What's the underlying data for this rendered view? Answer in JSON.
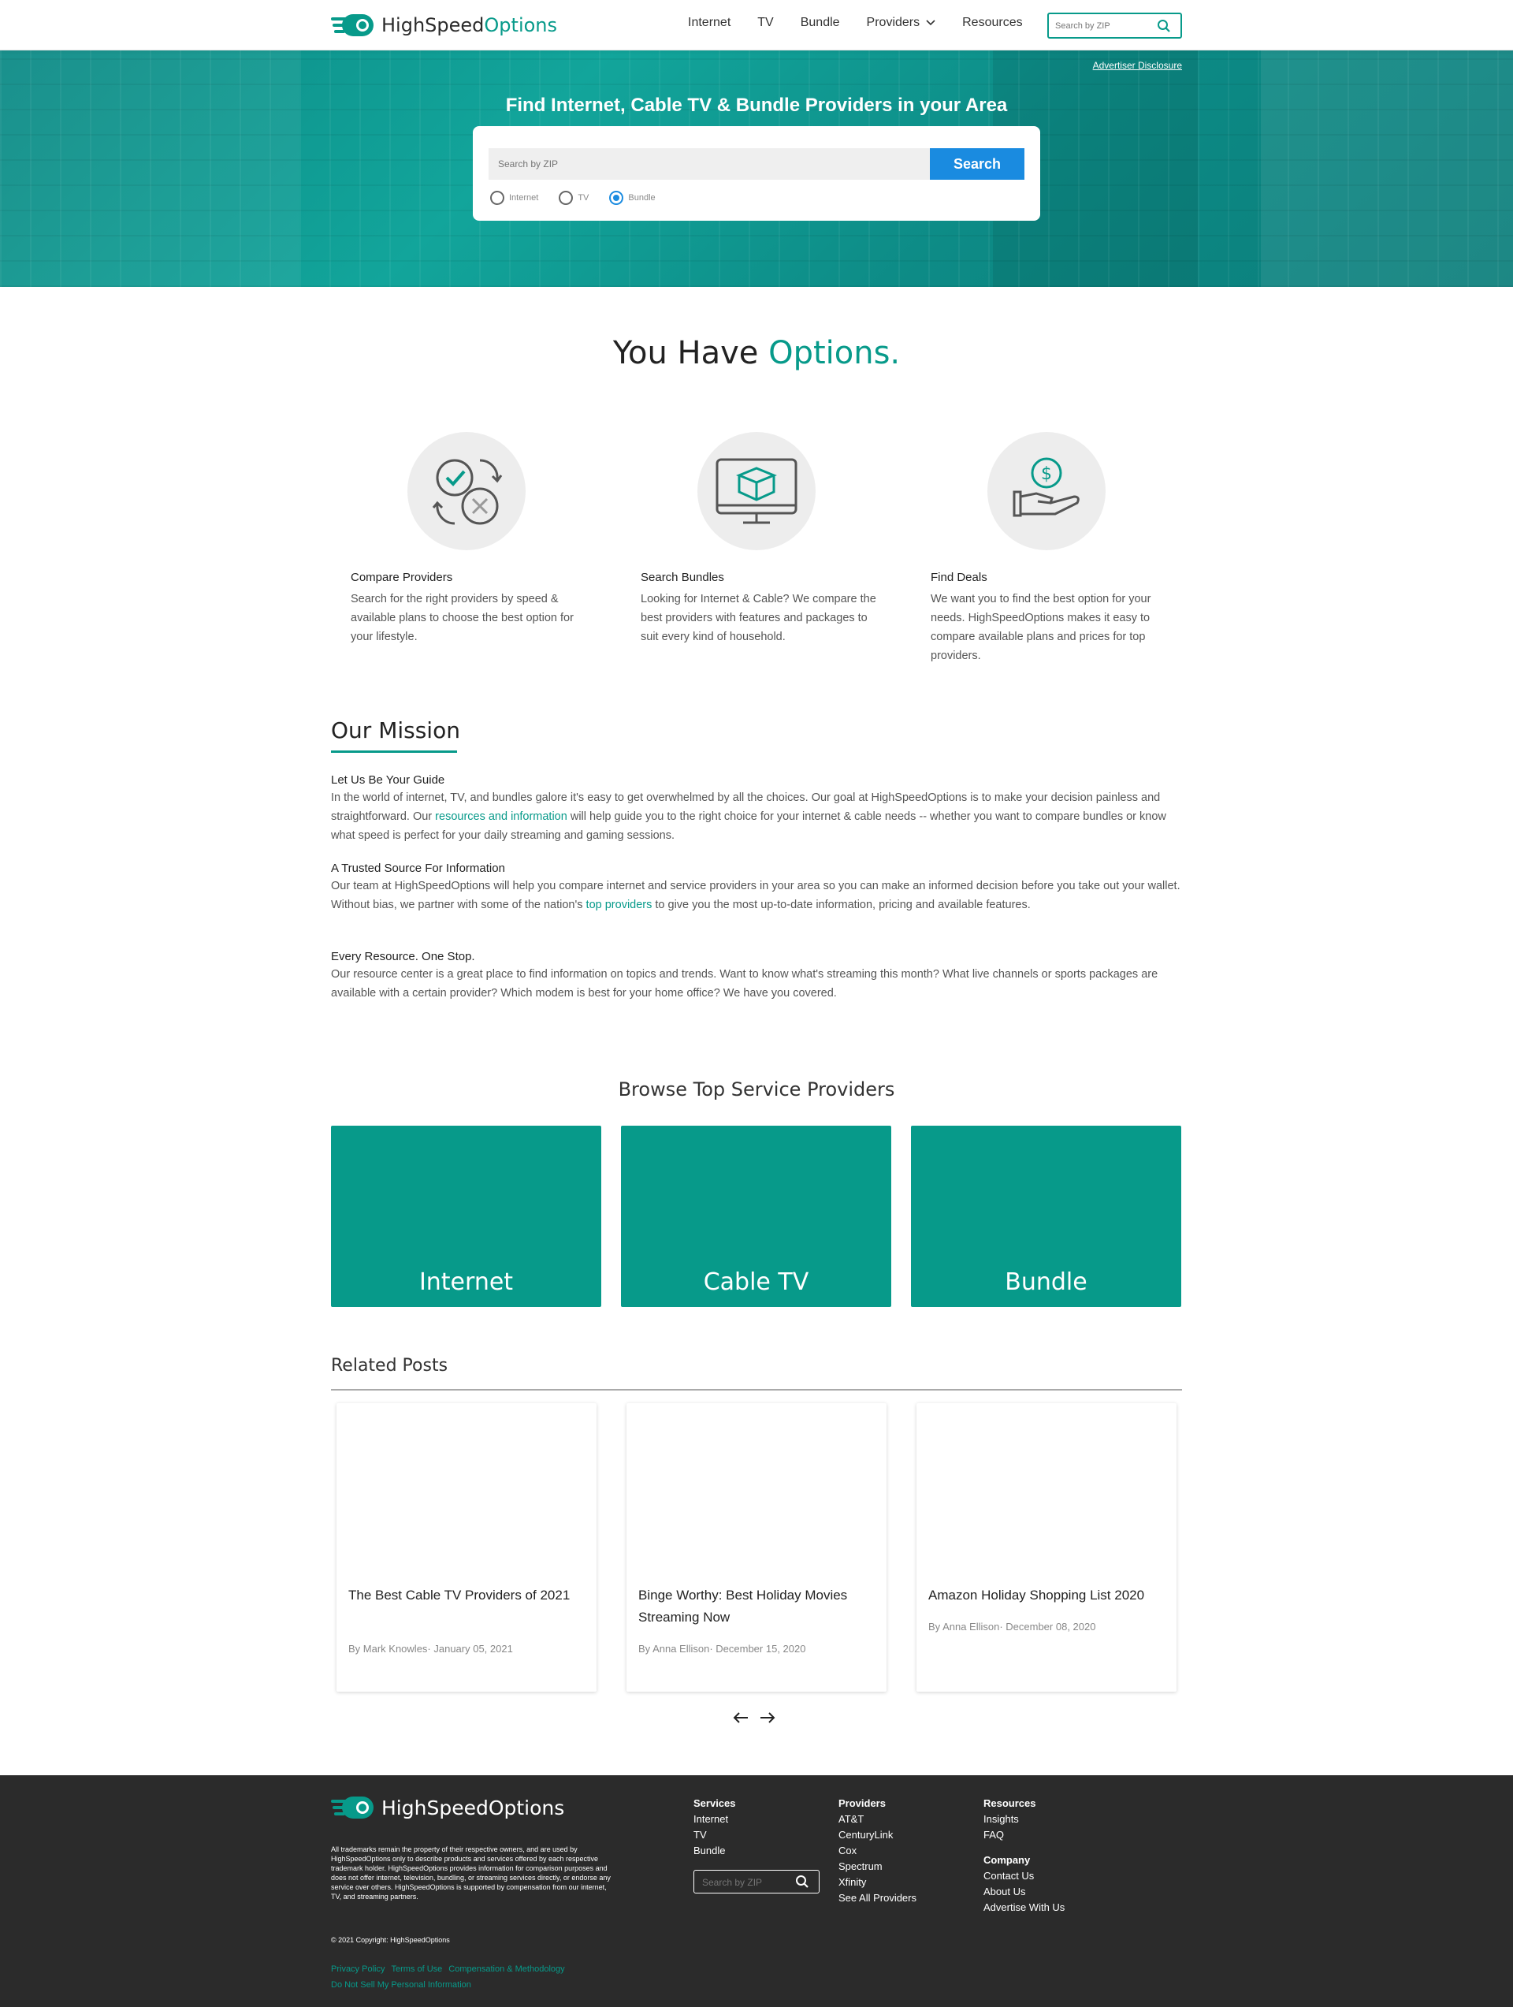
{
  "brand": {
    "name_part1": "HighSpeed",
    "name_part2": "Options",
    "full_name": "HighSpeedOptions",
    "accent_color": "#079a8a",
    "button_color": "#1a8be0"
  },
  "nav": {
    "items": [
      "Internet",
      "TV",
      "Bundle",
      "Providers",
      "Resources"
    ],
    "search_placeholder": "Search by ZIP"
  },
  "hero": {
    "disclosure": "Advertiser Disclosure",
    "title": "Find Internet, Cable TV & Bundle Providers in your Area",
    "zip_placeholder": "Search by ZIP",
    "search_button": "Search",
    "radios": [
      {
        "label": "Internet",
        "selected": false
      },
      {
        "label": "TV",
        "selected": false
      },
      {
        "label": "Bundle",
        "selected": true
      }
    ]
  },
  "options": {
    "title_part1": "You Have ",
    "title_part2": "Options.",
    "features": [
      {
        "icon": "compare-icon",
        "title": "Compare Providers",
        "text": "Search for the right providers by speed & available plans to choose the best option for your lifestyle."
      },
      {
        "icon": "monitor-box-icon",
        "title": "Search Bundles",
        "text": "Looking for Internet & Cable? We compare the best providers with features and packages to suit every kind of household."
      },
      {
        "icon": "hand-dollar-icon",
        "title": "Find Deals",
        "text": "We want you to find the best option for your needs. HighSpeedOptions makes it easy to compare available plans and prices for top providers."
      }
    ]
  },
  "mission": {
    "title": "Our Mission",
    "blocks": [
      {
        "heading": "Let Us Be Your Guide",
        "text_before": "In the world of internet, TV, and bundles galore it's easy to get overwhelmed by all the choices. Our goal at HighSpeedOptions is to make your decision painless and straightforward. Our ",
        "link": "resources and information",
        "text_after": " will help guide you to the right choice for your internet & cable needs -- whether you want to compare bundles or know what speed is perfect for your daily streaming and gaming sessions."
      },
      {
        "heading": "A Trusted Source For Information",
        "text_before": "Our team at HighSpeedOptions will help you compare internet and service providers in your area so you can make an informed decision before you take out your wallet. Without bias, we partner with some of the nation's ",
        "link": "top providers",
        "text_after": " to give you the most up-to-date information, pricing and available features."
      },
      {
        "heading": "Every Resource. One Stop.",
        "text_before": "Our resource center is a great place to find information on topics and trends. Want to know what's streaming this month? What live channels or sports packages are available with a certain provider? Which modem is best for your home office? We have you covered.",
        "link": "",
        "text_after": ""
      }
    ]
  },
  "browse": {
    "title": "Browse Top Service Providers",
    "tiles": [
      "Internet",
      "Cable TV",
      "Bundle"
    ]
  },
  "related": {
    "title": "Related Posts",
    "posts": [
      {
        "title": "The Best Cable TV Providers of 2021",
        "meta": "By Mark Knowles· January 05, 2021"
      },
      {
        "title": "Binge Worthy: Best Holiday Movies Streaming Now",
        "meta": "By Anna Ellison· December 15, 2020"
      },
      {
        "title": "Amazon Holiday Shopping List 2020",
        "meta": "By Anna Ellison· December 08, 2020"
      }
    ],
    "prev": "←",
    "next": "→"
  },
  "footer": {
    "disclaimer": "All trademarks remain the property of their respective owners, and are used by HighSpeedOptions only to describe products and services offered by each respective trademark holder. HighSpeedOptions provides information for comparison purposes and does not offer internet, television, bundling, or streaming services directly, or endorse any service over others. HighSpeedOptions is supported by compensation from our internet, TV, and streaming partners.",
    "copyright": "© 2021 Copyright: HighSpeedOptions",
    "legal_links": [
      "Privacy Policy",
      "Terms of Use",
      "Compensation & Methodology",
      "Do Not Sell My Personal Information"
    ],
    "services": {
      "heading": "Services",
      "items": [
        "Internet",
        "TV",
        "Bundle"
      ]
    },
    "providers": {
      "heading": "Providers",
      "items": [
        "AT&T",
        "CenturyLink",
        "Cox",
        "Spectrum",
        "Xfinity",
        "See All Providers"
      ]
    },
    "resources": {
      "heading": "Resources",
      "items": [
        "Insights",
        "FAQ"
      ]
    },
    "company": {
      "heading": "Company",
      "items": [
        "Contact Us",
        "About Us",
        "Advertise With Us"
      ]
    },
    "search_placeholder": "Search by ZIP"
  }
}
